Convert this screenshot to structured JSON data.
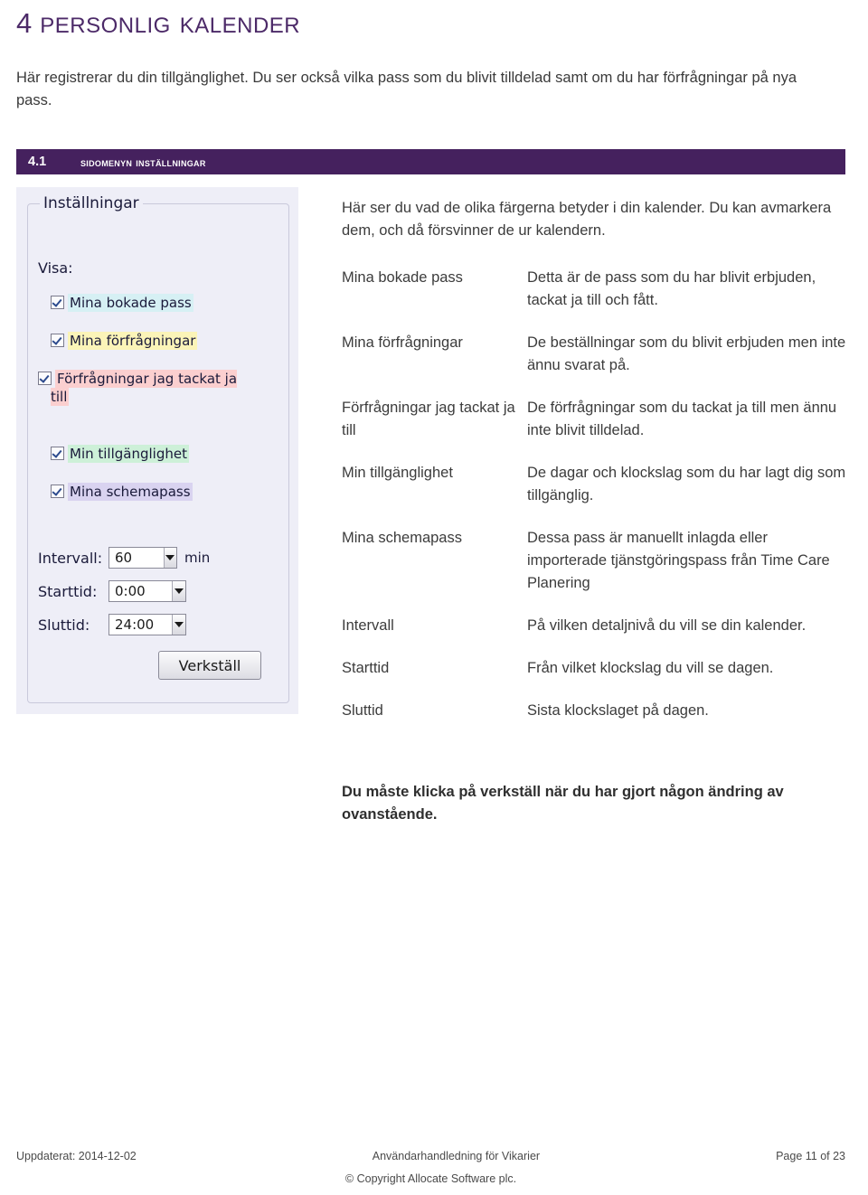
{
  "document": {
    "title_number": "4",
    "title_text": "Personlig kalender",
    "intro": "Här registrerar du din tillgänglighet. Du ser också vilka pass som du blivit tilldelad samt om du har förfrågningar på nya pass."
  },
  "section": {
    "number": "4.1",
    "title": "Sidomenyn inställningar",
    "bar_color": "#45215e",
    "heading_color": "#4c2a68"
  },
  "screenshot": {
    "groupbox_title": "Inställningar",
    "visa_label": "Visa:",
    "checkboxes": [
      {
        "label": "Mina bokade pass",
        "checked": true,
        "highlight": "#d6f0f4"
      },
      {
        "label": "Mina förfrågningar",
        "checked": true,
        "highlight": "#fbf4b8"
      },
      {
        "label": "Förfrågningar jag tackat ja till",
        "checked": true,
        "highlight": "#fbcfcf"
      },
      {
        "label": "Min tillgänglighet",
        "checked": true,
        "highlight": "#cdf0d8"
      },
      {
        "label": "Mina schemapass",
        "checked": true,
        "highlight": "#d9d3f0"
      }
    ],
    "fields": [
      {
        "label": "Intervall:",
        "value": "60",
        "unit": "min"
      },
      {
        "label": "Starttid:",
        "value": "0:00",
        "unit": ""
      },
      {
        "label": "Sluttid:",
        "value": "24:00",
        "unit": ""
      }
    ],
    "apply_button": "Verkställ"
  },
  "content": {
    "intro": "Här ser du vad de olika färgerna betyder i din kalender. Du kan avmarkera dem, och då försvinner de ur kalendern.",
    "rows": [
      {
        "label": "Mina bokade pass",
        "desc": "Detta är de pass som du har blivit erbjuden, tackat ja till och fått."
      },
      {
        "label": "Mina förfrågningar",
        "desc": "De beställningar som du blivit erbjuden men inte ännu svarat på."
      },
      {
        "label": "Förfrågningar jag tackat ja till",
        "desc": "De förfrågningar som du tackat ja till men ännu inte blivit tilldelad."
      },
      {
        "label": "Min tillgänglighet",
        "desc": "De dagar och klockslag som du har lagt dig som tillgänglig."
      },
      {
        "label": "Mina schemapass",
        "desc": "Dessa pass är manuellt inlagda eller importerade tjänstgöringspass från Time Care Planering"
      },
      {
        "label": "Intervall",
        "desc": "På vilken detaljnivå du vill se din kalender."
      },
      {
        "label": "Starttid",
        "desc": "Från vilket klockslag du vill se dagen."
      },
      {
        "label": "Sluttid",
        "desc": "Sista klockslaget på dagen."
      }
    ],
    "note": "Du måste klicka på verkställ när du har gjort någon ändring av ovanstående."
  },
  "footer": {
    "updated": "Uppdaterat: 2014-12-02",
    "center": "Användarhandledning för Vikarier",
    "page": "Page 11 of 23",
    "copyright": "© Copyright Allocate Software plc."
  }
}
